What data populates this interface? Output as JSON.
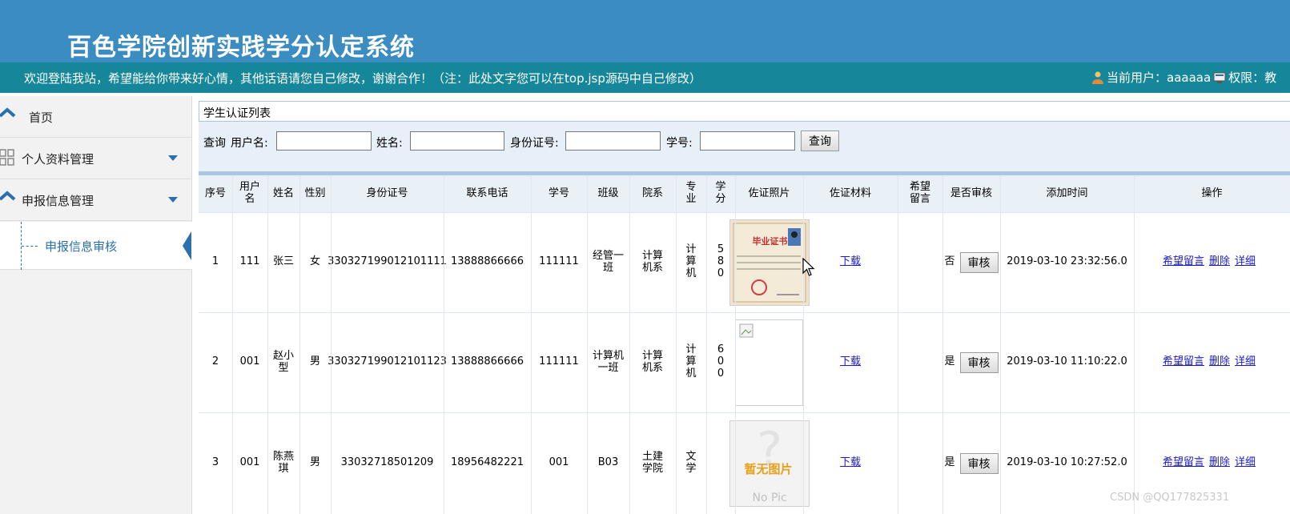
{
  "header": {
    "title": "百色学院创新实践学分认定系统",
    "welcome": "欢迎登陆我站，希望能给你带来好心情，其他话语请您自己修改，谢谢合作！（注：此处文字您可以在top.jsp源码中自己修改）",
    "current_user_label": "当前用户：aaaaaa",
    "permission_label": "权限：教"
  },
  "sidebar": {
    "items": [
      {
        "label": "首页"
      },
      {
        "label": "个人资料管理"
      },
      {
        "label": "申报信息管理"
      }
    ],
    "subitem": {
      "label": "申报信息审核"
    }
  },
  "content": {
    "breadcrumb": "学生认证列表",
    "search": {
      "query_label": "查询",
      "username_label": "用户名:",
      "name_label": "姓名:",
      "idcard_label": "身份证号:",
      "student_no_label": "学号:",
      "username_value": "",
      "name_value": "",
      "idcard_value": "",
      "student_no_value": "",
      "button": "查询"
    },
    "table": {
      "headers": [
        "序号",
        "用户名",
        "姓名",
        "性别",
        "身份证号",
        "联系电话",
        "学号",
        "班级",
        "院系",
        "专业",
        "学分",
        "佐证照片",
        "佐证材料",
        "希望留言",
        "是否审核",
        "添加时间",
        "操作"
      ],
      "rows": [
        {
          "no": "1",
          "username": "111",
          "name": "张三",
          "gender": "女",
          "idcard": "330327199012101111",
          "phone": "13888866666",
          "student_no": "111111",
          "class": "经管一班",
          "dept": "计算机系",
          "major": "计算机",
          "credit": "580",
          "photo": "certificate",
          "photo_caption": "毕业证书",
          "material": "下载",
          "message": "",
          "audited": "否",
          "audit_btn": "审核",
          "added": "2019-03-10 23:32:56.0",
          "actions": [
            "希望留言",
            "删除",
            "详细"
          ]
        },
        {
          "no": "2",
          "username": "001",
          "name": "赵小型",
          "gender": "男",
          "idcard": "330327199012101123",
          "phone": "13888866666",
          "student_no": "111111",
          "class": "计算机一班",
          "dept": "计算机系",
          "major": "计算机",
          "credit": "600",
          "photo": "broken",
          "photo_caption": "",
          "material": "下载",
          "message": "",
          "audited": "是",
          "audit_btn": "审核",
          "added": "2019-03-10 11:10:22.0",
          "actions": [
            "希望留言",
            "删除",
            "详细"
          ]
        },
        {
          "no": "3",
          "username": "001",
          "name": "陈燕琪",
          "gender": "男",
          "idcard": "33032718501209",
          "phone": "18956482221",
          "student_no": "001",
          "class": "B03",
          "dept": "土建学院",
          "major": "文学",
          "credit": "",
          "photo": "nopic",
          "photo_caption": "暂无图片",
          "photo_caption2": "No Pic",
          "material": "下载",
          "message": "",
          "audited": "是",
          "audit_btn": "审核",
          "added": "2019-03-10 10:27:52.0",
          "actions": [
            "希望留言",
            "删除",
            "详细"
          ]
        }
      ]
    }
  },
  "watermark": "CSDN @QQ177825331",
  "colors": {
    "header_bg": "#3b8dc1",
    "infobar_bg": "#16879a",
    "accent": "#2a6fb0",
    "link": "#1a1ad4"
  }
}
